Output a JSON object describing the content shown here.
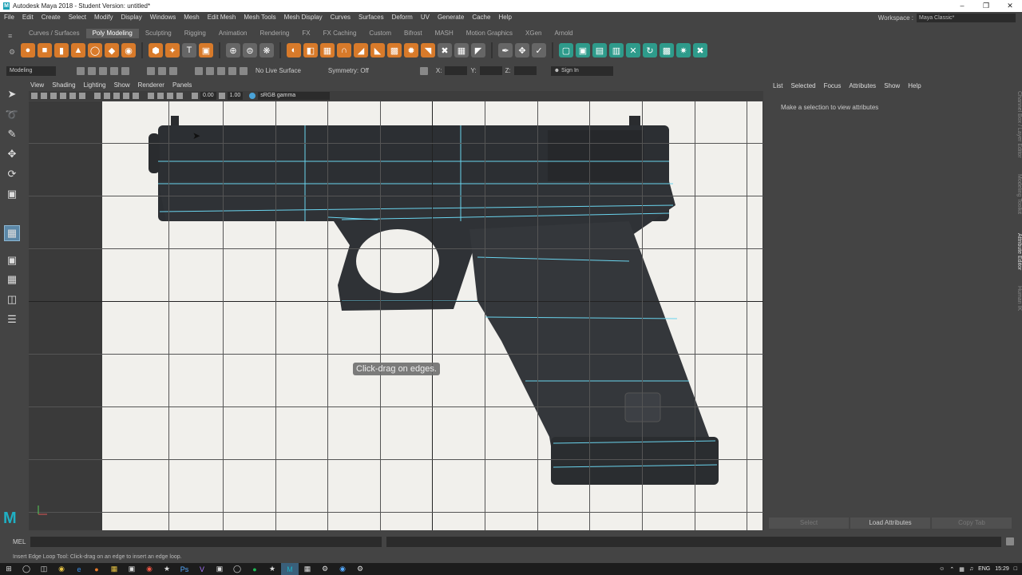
{
  "titlebar": {
    "title": "Autodesk Maya 2018 - Student Version: untitled*",
    "logo": "M"
  },
  "menubar": {
    "items": [
      "File",
      "Edit",
      "Create",
      "Select",
      "Modify",
      "Display",
      "Windows",
      "Mesh",
      "Edit Mesh",
      "Mesh Tools",
      "Mesh Display",
      "Curves",
      "Surfaces",
      "Deform",
      "UV",
      "Generate",
      "Cache",
      "Help"
    ]
  },
  "workspace": {
    "label": "Workspace :",
    "value": "Maya Classic*"
  },
  "shelf": {
    "tabs": [
      "Curves / Surfaces",
      "Poly Modeling",
      "Sculpting",
      "Rigging",
      "Animation",
      "Rendering",
      "FX",
      "FX Caching",
      "Custom",
      "Bifrost",
      "MASH",
      "Motion Graphics",
      "XGen",
      "Arnold"
    ],
    "active": "Poly Modeling"
  },
  "statusline": {
    "mode": "Modeling",
    "live_surface": "No Live Surface",
    "symmetry": "Symmetry: Off",
    "x_label": "X:",
    "y_label": "Y:",
    "z_label": "Z:",
    "sign_in": "Sign In"
  },
  "viewport": {
    "menu": [
      "View",
      "Shading",
      "Lighting",
      "Show",
      "Renderer",
      "Panels"
    ],
    "field1": "0.00",
    "field2": "1.00",
    "colorspace": "sRGB gamma",
    "hint": "Click-drag on edges."
  },
  "attr": {
    "menu": [
      "List",
      "Selected",
      "Focus",
      "Attributes",
      "Show",
      "Help"
    ],
    "message": "Make a selection to view attributes",
    "buttons": [
      "Select",
      "Load Attributes",
      "Copy Tab"
    ]
  },
  "sidetabs": [
    "Channel Box / Layer Editor",
    "Modeling Toolkit",
    "Attribute Editor",
    "Human IK"
  ],
  "cmdline": {
    "label": "MEL"
  },
  "helpline": "Insert Edge Loop Tool: Click-drag on an edge to insert an edge loop.",
  "taskbar": {
    "lang": "ENG",
    "time": "15:29"
  },
  "colors": {
    "accent": "#5b87a7",
    "shelf_orange": "#d87a2a",
    "shelf_teal": "#2e9b8b"
  }
}
